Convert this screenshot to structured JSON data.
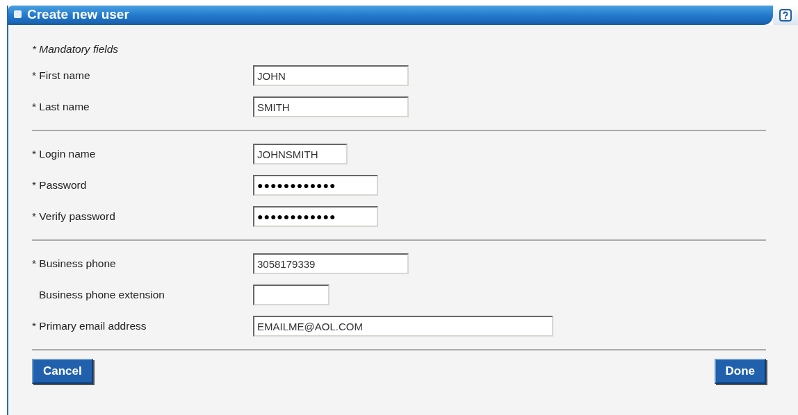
{
  "window": {
    "title": "Create new user"
  },
  "note": "* Mandatory fields",
  "groups": [
    {
      "fields": [
        {
          "label": "* First name",
          "required": true,
          "value": "JOHN"
        },
        {
          "label": "* Last name",
          "required": true,
          "value": "SMITH"
        }
      ]
    },
    {
      "fields": [
        {
          "label": "* Login name",
          "required": true,
          "value": "JOHNSMITH"
        },
        {
          "label": "* Password",
          "required": true,
          "value": "●●●●●●●●●●●●"
        },
        {
          "label": "* Verify password",
          "required": true,
          "value": "●●●●●●●●●●●●"
        }
      ]
    },
    {
      "fields": [
        {
          "label": "* Business phone",
          "required": true,
          "value": "3058179339"
        },
        {
          "label": "Business phone extension",
          "required": false
        },
        {
          "label": "* Primary email address",
          "required": true,
          "value": "EMAILME@AOL.COM"
        }
      ]
    }
  ],
  "buttons": {
    "cancel": "Cancel",
    "done": "Done"
  }
}
